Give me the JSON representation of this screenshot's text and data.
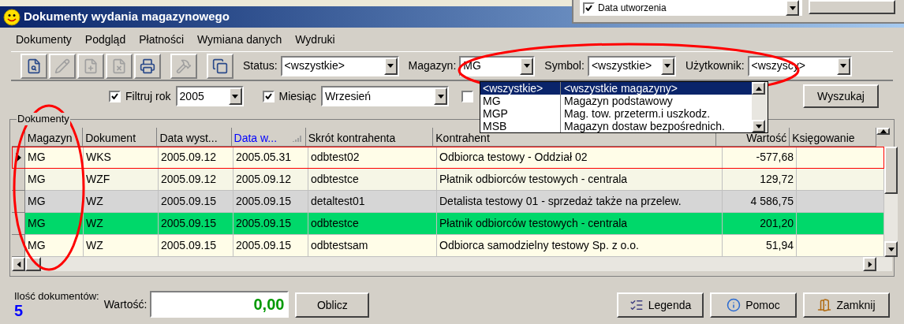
{
  "background_window": {
    "list_item": {
      "label": "Data utworzenia",
      "checked": true
    }
  },
  "window": {
    "title": "Dokumenty wydania magazynowego"
  },
  "menu": [
    "Dokumenty",
    "Podgląd",
    "Płatności",
    "Wymiana danych",
    "Wydruki"
  ],
  "toolbar": [
    {
      "kind": "view",
      "disabled": false
    },
    {
      "kind": "edit",
      "disabled": true
    },
    {
      "kind": "add",
      "disabled": true
    },
    {
      "kind": "delete",
      "disabled": true
    },
    {
      "kind": "print",
      "disabled": false
    },
    {
      "kind": "tools",
      "disabled": true
    },
    {
      "kind": "copy",
      "disabled": false
    }
  ],
  "filters": [
    {
      "label": "Status:",
      "value": "<wszystkie>"
    },
    {
      "label": "Magazyn:",
      "value": "MG"
    },
    {
      "label": "Symbol:",
      "value": "<wszystkie>"
    },
    {
      "label": "Użytkownik:",
      "value": "<wszyscy>"
    }
  ],
  "year_filter": {
    "label": "Filtruj rok",
    "checked": true,
    "value": "2005"
  },
  "month_filter": {
    "label": "Miesiąc",
    "checked": true,
    "value": "Wrzesień"
  },
  "extra_checkbox": {
    "checked": false
  },
  "search_button": "Wyszukaj",
  "dropdown": [
    {
      "code": "<wszystkie>",
      "name": "<wszystkie magazyny>",
      "selected": true
    },
    {
      "code": "MG",
      "name": "Magazyn podstawowy",
      "selected": false
    },
    {
      "code": "MGP",
      "name": "Mag. tow. przeterm.i uszkodz.",
      "selected": false
    },
    {
      "code": "MSB",
      "name": "Magazyn dostaw bezpośrednich.",
      "selected": false
    }
  ],
  "table": {
    "group_title": "Dokumenty",
    "columns": [
      {
        "label": "Magazyn",
        "sorted": false
      },
      {
        "label": "Dokument",
        "sorted": false
      },
      {
        "label": "Data wyst...",
        "sorted": false
      },
      {
        "label": "Data w...",
        "sorted": true
      },
      {
        "label": "Skrót kontrahenta",
        "sorted": false
      },
      {
        "label": "Kontrahent",
        "sorted": false
      },
      {
        "label": "Wartość",
        "sorted": false
      },
      {
        "label": "Księgowanie",
        "sorted": false
      }
    ],
    "rows": [
      {
        "selected": true,
        "color": "#fffde8",
        "cells": [
          "MG",
          "WKS",
          "2005.09.12",
          "2005.05.31",
          "odbtest02",
          "Odbiorca testowy - Oddział 02",
          "-577,68",
          ""
        ]
      },
      {
        "selected": false,
        "color": "#f6f6e6",
        "cells": [
          "MG",
          "WZF",
          "2005.09.12",
          "2005.09.12",
          "odbtestce",
          "Płatnik odbiorców testowych - centrala",
          "129,72",
          ""
        ]
      },
      {
        "selected": false,
        "color": "#d6d6d6",
        "cells": [
          "MG",
          "WZ",
          "2005.09.15",
          "2005.09.15",
          "detaltest01",
          "Detalista testowy 01 - sprzedaż także na przelew.",
          "4 586,75",
          ""
        ]
      },
      {
        "selected": false,
        "color": "#00d86a",
        "cells": [
          "MG",
          "WZ",
          "2005.09.15",
          "2005.09.15",
          "odbtestce",
          "Płatnik odbiorców testowych - centrala",
          "201,20",
          ""
        ]
      },
      {
        "selected": false,
        "color": "#fffde8",
        "cells": [
          "MG",
          "WZ",
          "2005.09.15",
          "2005.09.15",
          "odbtestsam",
          "Odbiorca samodzielny testowy Sp. z o.o.",
          "51,94",
          ""
        ]
      }
    ]
  },
  "footer": {
    "count_label": "Ilość dokumentów:",
    "count": "5",
    "value_label": "Wartość:",
    "value": "0,00",
    "buttons": [
      {
        "kind": "calc",
        "label": "Oblicz"
      },
      {
        "kind": "legend",
        "label": "Legenda"
      },
      {
        "kind": "help",
        "label": "Pomoc"
      },
      {
        "kind": "close",
        "label": "Zamknij"
      }
    ]
  }
}
